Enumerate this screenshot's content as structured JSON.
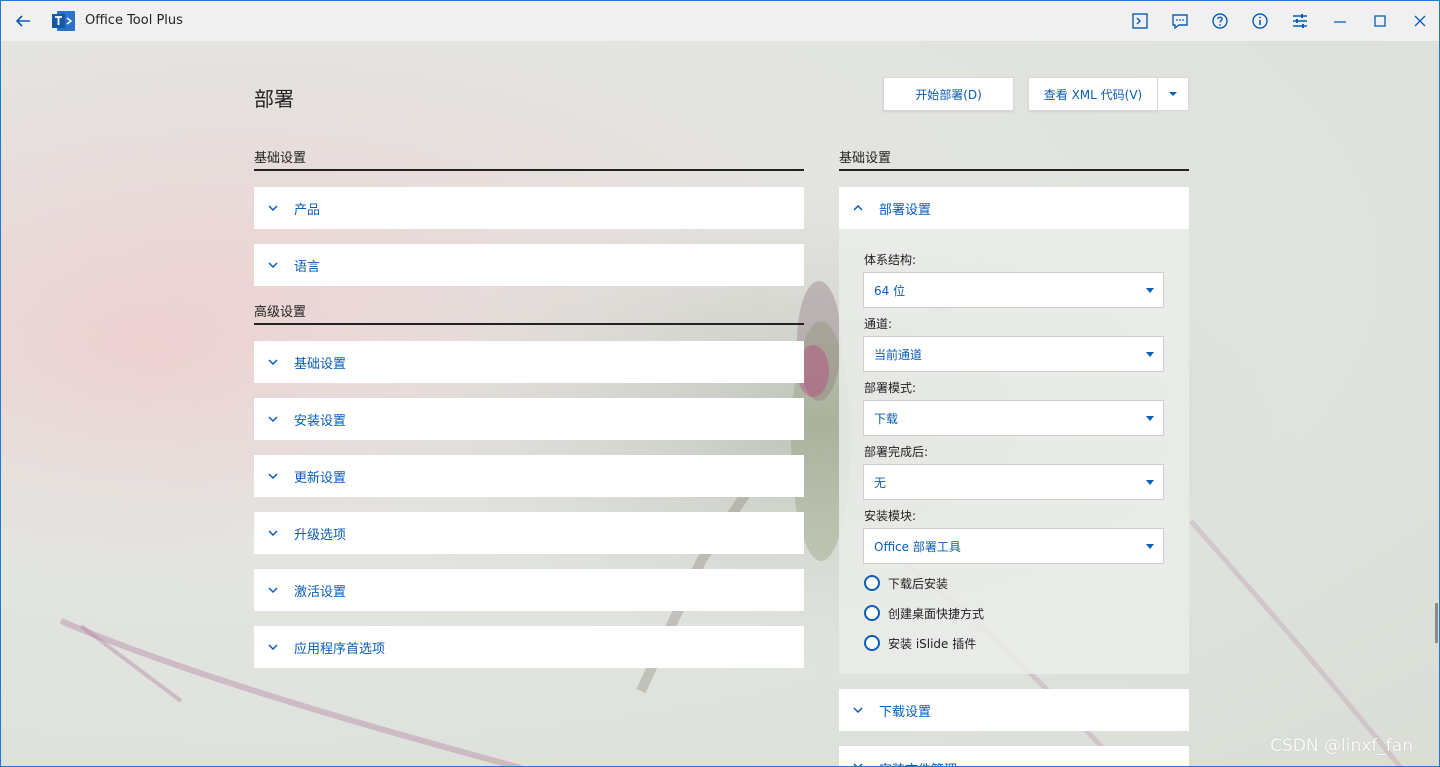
{
  "app": {
    "title": "Office Tool Plus"
  },
  "page": {
    "title": "部署",
    "start_button": "开始部署(D)",
    "xml_button": "查看 XML 代码(V)"
  },
  "left": {
    "basic_title": "基础设置",
    "basic_panels": [
      "产品",
      "语言"
    ],
    "advanced_title": "高级设置",
    "advanced_panels": [
      "基础设置",
      "安装设置",
      "更新设置",
      "升级选项",
      "激活设置",
      "应用程序首选项"
    ]
  },
  "right": {
    "section_title": "基础设置",
    "deploy_settings": {
      "header": "部署设置",
      "architecture_label": "体系结构:",
      "architecture_value": "64 位",
      "channel_label": "通道:",
      "channel_value": "当前通道",
      "mode_label": "部署模式:",
      "mode_value": "下载",
      "after_label": "部署完成后:",
      "after_value": "无",
      "module_label": "安装模块:",
      "module_value": "Office 部署工具",
      "options": [
        "下载后安装",
        "创建桌面快捷方式",
        "安装 iSlide 插件"
      ]
    },
    "download_settings": "下载设置",
    "install_files": "安装文件管理"
  },
  "watermark": "CSDN @linxf_fan",
  "colors": {
    "accent": "#0a5db8",
    "window_border": "#1c7ad4",
    "titlebar": "#f0f0f0"
  }
}
